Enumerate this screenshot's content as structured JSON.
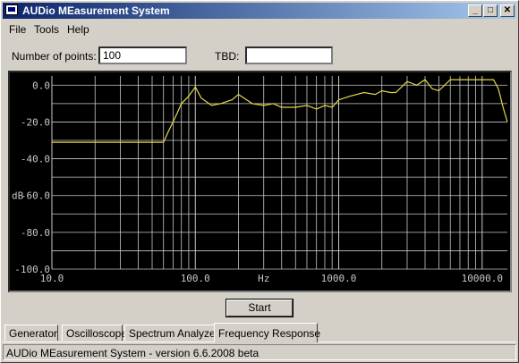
{
  "window": {
    "title": "AUDio MEasurement System",
    "controls": {
      "minimize": "_",
      "maximize": "□",
      "close": "✕"
    }
  },
  "menu": {
    "items": [
      "File",
      "Tools",
      "Help"
    ]
  },
  "form": {
    "points_label": "Number of points:",
    "points_value": "100",
    "tbd_label": "TBD:",
    "tbd_value": ""
  },
  "start_button": "Start",
  "tabs": [
    "Generator",
    "Oscilloscope",
    "Spectrum Analyzer",
    "Frequency Response"
  ],
  "active_tab": "Frequency Response",
  "status": "AUDio MEasurement System - version 6.6.2008 beta",
  "icons": {
    "app": "window-icon"
  },
  "colors": {
    "trace": "#e6d84a",
    "grid": "#c8c8c8",
    "plot_bg": "#000000",
    "title_start": "#0a246a",
    "title_end": "#a6caf0"
  },
  "chart_data": {
    "type": "line",
    "title": "",
    "xlabel": "Hz",
    "ylabel": "dB",
    "xscale": "log",
    "xlim": [
      10,
      15000
    ],
    "ylim": [
      -100,
      5
    ],
    "x_ticks": [
      10,
      100,
      1000,
      10000
    ],
    "x_tick_labels": [
      "10.0",
      "100.0",
      "1000.0",
      "10000.0"
    ],
    "y_ticks": [
      0,
      -20,
      -40,
      -60,
      -80,
      -100
    ],
    "y_tick_labels": [
      "0.0",
      "-20.0",
      "-40.0",
      "-60.0",
      "-80.0",
      "-100.0"
    ],
    "grid": true,
    "series": [
      {
        "x": [
          10,
          20,
          40,
          60,
          65,
          70,
          75,
          80,
          90,
          100,
          110,
          130,
          150,
          180,
          200,
          250,
          300,
          350,
          400,
          500,
          600,
          700,
          800,
          900,
          1000,
          1200,
          1500,
          1800,
          2000,
          2300,
          2500,
          3000,
          3500,
          4000,
          4500,
          5000,
          6000,
          7000,
          8000,
          10000,
          12000,
          13000,
          14000,
          15000
        ],
        "y": [
          -31,
          -31,
          -31,
          -31,
          -25,
          -20,
          -15,
          -10,
          -6,
          -1,
          -7,
          -11,
          -10,
          -8,
          -5,
          -10,
          -11,
          -10,
          -12,
          -12,
          -11,
          -13,
          -11,
          -12,
          -8,
          -6,
          -4,
          -5,
          -3,
          -4,
          -4,
          2,
          0,
          3,
          -2,
          -3,
          3,
          3,
          3,
          3,
          3,
          -2,
          -12,
          -20
        ]
      }
    ]
  }
}
